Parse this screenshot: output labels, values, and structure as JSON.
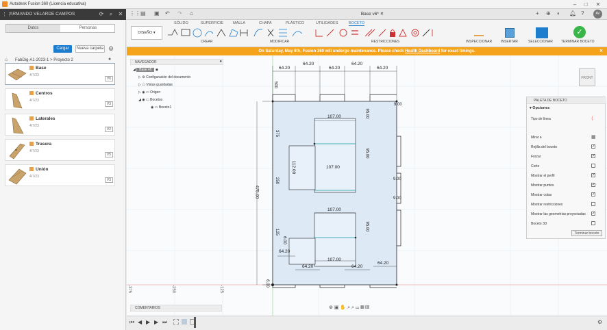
{
  "app": {
    "title": "Autodesk Fusion 360 (Licencia educativa)"
  },
  "left_panel": {
    "user": "ARMANDO VELARDE CAMPOS",
    "tabs": [
      "Datos",
      "Personas"
    ],
    "upload_label": "Cargar",
    "new_folder_label": "Nueva carpeta",
    "breadcrumb": "FabDig-A1-2023-1  >  Proyecto 2",
    "files": [
      {
        "name": "Base",
        "date": "4/7/23",
        "version": "V6"
      },
      {
        "name": "Centros",
        "date": "4/7/23",
        "version": "V3"
      },
      {
        "name": "Laterales",
        "date": "4/7/23",
        "version": "V2"
      },
      {
        "name": "Trasera",
        "date": "4/7/23",
        "version": "V5"
      },
      {
        "name": "Unión",
        "date": "4/7/23",
        "version": "V3"
      }
    ]
  },
  "document_tab": "Base v6*",
  "user_initials": "AV",
  "ribbon": {
    "tabs": [
      "SÓLIDO",
      "SUPERFICIE",
      "MALLA",
      "CHAPA",
      "PLÁSTICO",
      "UTILIDADES",
      "BOCETO"
    ],
    "active_tab": "BOCETO",
    "workspace": "DISEÑO",
    "groups": [
      "CREAR",
      "MODIFICAR",
      "RESTRICCIONES",
      "INSPECCIONAR",
      "INSERTAR",
      "SELECCIONAR",
      "TERMINAR BOCETO"
    ]
  },
  "banner": {
    "text_before": "On Saturday, May 6th, Fusion 360 will undergo maintenance. Please check ",
    "link": "Health Dashboard",
    "text_after": " for exact timings."
  },
  "navigator": {
    "title": "NAVEGADOR",
    "root": "Base v6",
    "items": [
      "Configuración del documento",
      "Vistas guardadas",
      "Origen",
      "Bocetos",
      "Boceto1"
    ]
  },
  "comments_label": "COMENTARIOS",
  "viewcube_label": "FRONT",
  "palette": {
    "title": "PALETA DE BOCETO",
    "section": "Opciones",
    "rows": [
      {
        "label": "Tipo de línea",
        "checked": null
      },
      {
        "label": "Mirar a",
        "checked": null
      },
      {
        "label": "Rejilla del boceto",
        "checked": true
      },
      {
        "label": "Forzar",
        "checked": true
      },
      {
        "label": "Corte",
        "checked": false
      },
      {
        "label": "Mostrar el perfil",
        "checked": true
      },
      {
        "label": "Mostrar puntos",
        "checked": true
      },
      {
        "label": "Mostrar cotas",
        "checked": true
      },
      {
        "label": "Mostrar restricciones",
        "checked": false
      },
      {
        "label": "Mostrar las geometrías proyectadas",
        "checked": true
      },
      {
        "label": "Boceto 3D",
        "checked": false
      }
    ],
    "finish_label": "Terminar boceto"
  },
  "canvas": {
    "ruler_labels": [
      "-375",
      "-250",
      "-125"
    ],
    "dims": {
      "top_widths": [
        "64.20",
        "64.20",
        "64.20",
        "64.20",
        "64.20"
      ],
      "slot_500": "500",
      "d107": "107.00",
      "d95": "95.00",
      "d900": "9.00",
      "d6": "6.00",
      "d375": "375",
      "d475": "475.00",
      "d112": "112.00",
      "d250": "250",
      "d125": "125",
      "d642": "64.20"
    }
  }
}
